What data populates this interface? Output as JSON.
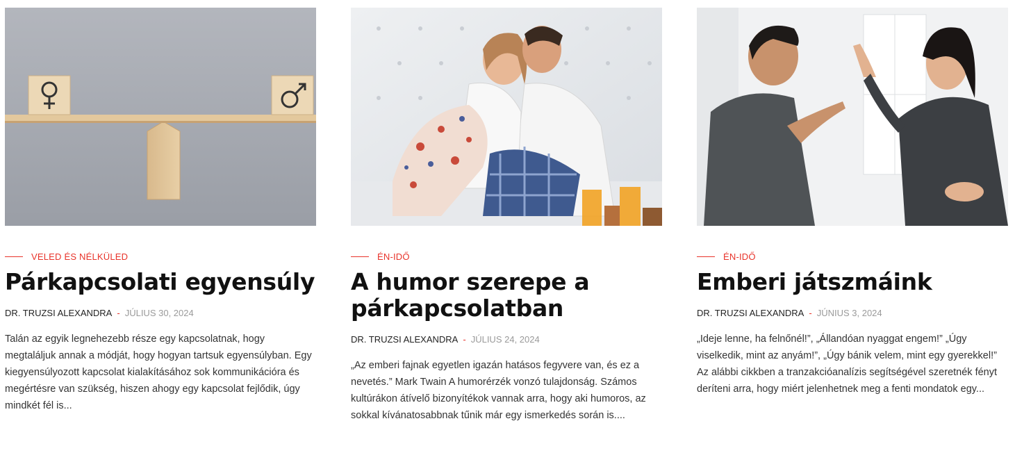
{
  "accent_color": "#e8332a",
  "posts": [
    {
      "category": "VELED ÉS NÉLKÜLED",
      "title": "Párkapcsolati egyensúly",
      "author": "DR. TRUZSI ALEXANDRA",
      "separator": "-",
      "date": "JÚLIUS 30, 2024",
      "excerpt": "Talán az egyik legnehezebb része egy kapcsolatnak, hogy megtaláljuk annak a módját, hogy hogyan tartsuk egyensúlyban. Egy kiegyensúlyozott kapcsolat kialakításához sok kommunikációra és megértésre van szükség, hiszen ahogy egy kapcsolat fejlődik, úgy mindkét fél is...",
      "image_icon": "balance-scale-gender-blocks-image"
    },
    {
      "category": "ÉN-IDŐ",
      "title": "A humor szerepe a párkapcsolatban",
      "author": "DR. TRUZSI ALEXANDRA",
      "separator": "-",
      "date": "JÚLIUS 24, 2024",
      "excerpt": "„Az emberi fajnak egyetlen igazán hatásos fegyvere van, és ez a nevetés.” Mark Twain A humorérzék vonzó tulajdonság. Számos kultúrákon átívelő bizonyítékok vannak arra, hogy aki humoros, az sokkal kívánatosabbnak tűnik már egy ismerkedés során is....",
      "image_icon": "laughing-couple-in-bed-image"
    },
    {
      "category": "ÉN-IDŐ",
      "title": "Emberi játszmáink",
      "author": "DR. TRUZSI ALEXANDRA",
      "separator": "-",
      "date": "JÚNIUS 3, 2024",
      "excerpt": "„Ideje lenne, ha felnőnél!”, „Állandóan nyaggat engem!” „Úgy viselkedik, mint az anyám!”, „Úgy bánik velem, mint egy gyerekkel!” Az alábbi cikkben a tranzakcióanalízis segítségével szeretnék fényt deríteni arra, hogy miért jelenhetnek meg a fenti mondatok egy...",
      "image_icon": "arguing-couple-pointing-image"
    }
  ]
}
